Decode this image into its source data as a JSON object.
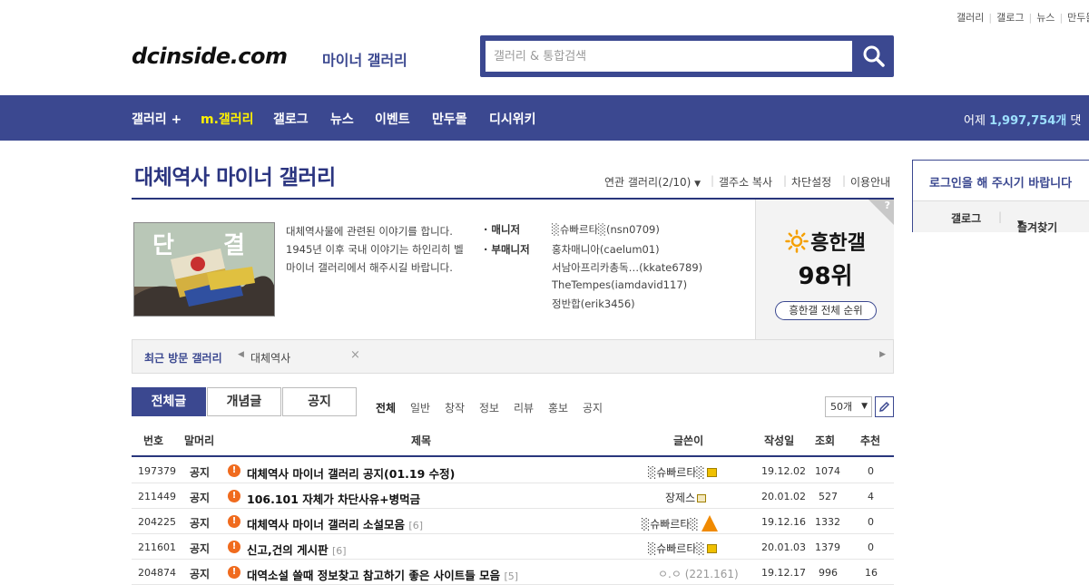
{
  "top_links": [
    "갤러리",
    "갤로그",
    "뉴스",
    "만두몰"
  ],
  "logo": {
    "text": "dcinside.com",
    "sub": "마이너 갤러리"
  },
  "search": {
    "placeholder": "갤러리 & 통합검색"
  },
  "nav": {
    "items": [
      "갤러리 +",
      "m.갤러리",
      "갤로그",
      "뉴스",
      "이벤트",
      "만두몰",
      "디시위키"
    ],
    "yesterday_label": "어제",
    "yesterday_count": "1,997,754개",
    "yesterday_tail": "댓"
  },
  "gallery": {
    "title": "대체역사 마이너 갤러리",
    "links": [
      "연관 갤러리(2/10)",
      "갤주소 복사",
      "차단설정",
      "이용안내"
    ],
    "thumb_text": [
      "단",
      "결"
    ],
    "description": [
      "대체역사물에 관련된 이야기를 합니다.",
      "1945년 이후 국내 이야기는 하인리히 벨",
      "마이너 갤러리에서 해주시길 바랍니다."
    ],
    "manager_label": "매니저",
    "manager": "░슈빠르타░(nsn0709)",
    "sub_manager_label": "부매니저",
    "sub_managers": [
      "홍차매니아(caelum01)",
      "서남아프리카총독…(kkate6789)",
      "TheTempes(iamdavid117)",
      "정반합(erik3456)"
    ]
  },
  "rank": {
    "label": "흥한갤",
    "value": "98위",
    "button": "흥한갤 전체 순위",
    "help": "?"
  },
  "recent": {
    "label": "최근 방문 갤러리",
    "items": [
      "대체역사"
    ]
  },
  "tabs": [
    "전체글",
    "개념글",
    "공지"
  ],
  "categories": [
    "전체",
    "일반",
    "창작",
    "정보",
    "리뷰",
    "홍보",
    "공지"
  ],
  "page_size": "50개",
  "table": {
    "headers": [
      "번호",
      "말머리",
      "제목",
      "글쓴이",
      "작성일",
      "조회",
      "추천"
    ],
    "rows": [
      {
        "num": "197379",
        "head": "공지",
        "title": "대체역사 마이너 갤러리 공지(01.19 수정)",
        "count": "",
        "writer": "░슈빠르타░",
        "date": "19.12.02",
        "views": "1074",
        "likes": "0"
      },
      {
        "num": "211449",
        "head": "공지",
        "title": "106.101 자체가 차단사유+병먹금",
        "count": "",
        "writer": "장제스",
        "date": "20.01.02",
        "views": "527",
        "likes": "4"
      },
      {
        "num": "204225",
        "head": "공지",
        "title": "대체역사 마이너 갤러리 소설모음",
        "count": "[6]",
        "writer": "░슈빠르타░",
        "date": "19.12.16",
        "views": "1332",
        "likes": "0"
      },
      {
        "num": "211601",
        "head": "공지",
        "title": "신고,건의 게시판",
        "count": "[6]",
        "writer": "░슈빠르타░",
        "date": "20.01.03",
        "views": "1379",
        "likes": "0"
      },
      {
        "num": "204874",
        "head": "공지",
        "title": "대역소설 쓸때 정보찾고 참고하기 좋은 사이트들 모음",
        "count": "[5]",
        "writer": "ㅇ.ㅇ (221.161)",
        "date": "19.12.17",
        "views": "996",
        "likes": "16"
      }
    ]
  },
  "login": {
    "message": "로그인을 해 주시기 바랍니다",
    "links": [
      "갤로그",
      "즐겨찾기"
    ]
  },
  "colors": {
    "brand": "#3b4890",
    "nav_highlight": "#fff200",
    "notice_icon": "#f06b1e"
  }
}
